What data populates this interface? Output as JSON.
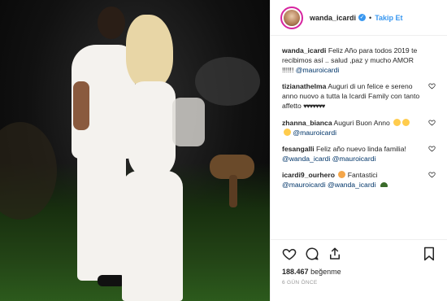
{
  "header": {
    "username": "wanda_icardi",
    "verified_glyph": "✓",
    "separator": "•",
    "follow_label": "Takip Et",
    "icon": "verified-badge-icon"
  },
  "caption": {
    "username": "wanda_icardi",
    "text": "Feliz Año para todos 2019 te recibimos así .. salud ,paz y mucho AMOR !!!!!!",
    "mention": "@mauroicardi"
  },
  "comments": [
    {
      "username": "tizianathelma",
      "text": "Auguri di un felice e sereno anno nuovo a tutta la Icardi Family con tanto affetto",
      "suffix": "♥♥♥♥♥♥♥"
    },
    {
      "username": "zhanna_bianca",
      "text": "Auguri Buon Anno",
      "mention": "@mauroicardi"
    },
    {
      "username": "fesangalli",
      "text": "Feliz año nuevo linda familia!",
      "mention1": "@wanda_icardi",
      "mention2": "@mauroicardi"
    },
    {
      "username": "icardi9_ourhero",
      "text": "Fantastici",
      "mention1": "@mauroicardi",
      "mention2": "@wanda_icardi"
    }
  ],
  "actions": {
    "icons": [
      "heart-icon",
      "comment-icon",
      "share-icon",
      "bookmark-icon"
    ]
  },
  "likes": {
    "count": "188.467",
    "label": "beğenme"
  },
  "timestamp": "6 GÜN ÖNCE",
  "colors": {
    "link": "#3897f0",
    "mention": "#003569",
    "verified": "#3897f0",
    "border": "#efefef"
  }
}
